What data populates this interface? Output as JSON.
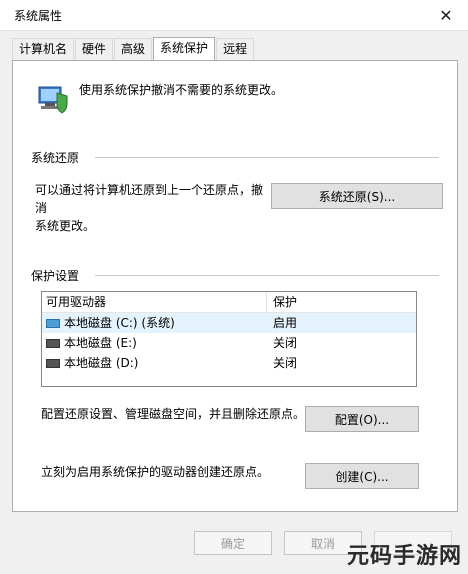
{
  "window": {
    "title": "系统属性"
  },
  "tabs": [
    {
      "label": "计算机名"
    },
    {
      "label": "硬件"
    },
    {
      "label": "高级"
    },
    {
      "label": "系统保护"
    },
    {
      "label": "远程"
    }
  ],
  "intro_text": "使用系统保护撤消不需要的系统更改。",
  "restore": {
    "heading": "系统还原",
    "desc_line1": "可以通过将计算机还原到上一个还原点，撤消",
    "desc_line2": "系统更改。",
    "button": "系统还原(S)..."
  },
  "protection": {
    "heading": "保护设置",
    "columns": [
      "可用驱动器",
      "保护"
    ],
    "drives": [
      {
        "name": "本地磁盘 (C:) (系统)",
        "status": "启用"
      },
      {
        "name": "本地磁盘 (E:)",
        "status": "关闭"
      },
      {
        "name": "本地磁盘 (D:)",
        "status": "关闭"
      }
    ],
    "configure_desc": "配置还原设置、管理磁盘空间，并且删除还原点。",
    "configure_button": "配置(O)...",
    "create_desc": "立刻为启用系统保护的驱动器创建还原点。",
    "create_button": "创建(C)..."
  },
  "footer": {
    "ok": "确定",
    "cancel": "取消",
    "apply": ""
  },
  "watermark": "元码手游网"
}
